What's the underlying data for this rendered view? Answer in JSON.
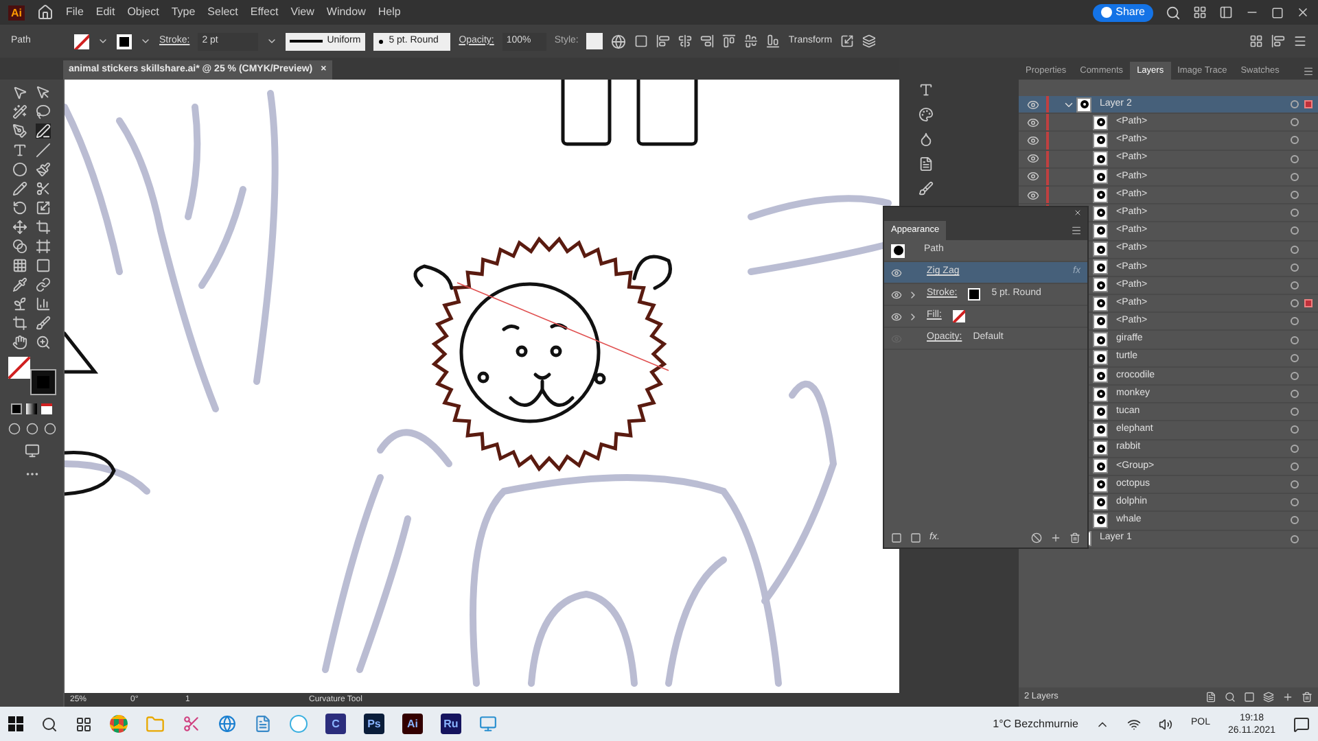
{
  "app": {
    "logo": "Ai",
    "menu": [
      "File",
      "Edit",
      "Object",
      "Type",
      "Select",
      "Effect",
      "View",
      "Window",
      "Help"
    ],
    "share_button": "Share"
  },
  "control_bar": {
    "selection": "Path",
    "stroke_label": "Stroke:",
    "stroke_weight": "2 pt",
    "profile": "Uniform",
    "brush": "5 pt. Round",
    "opacity_label": "Opacity:",
    "opacity": "100%",
    "style_label": "Style:",
    "transform": "Transform"
  },
  "document_tab": {
    "title": "animal stickers skillshare.ai* @ 25 % (CMYK/Preview)",
    "close": "×"
  },
  "panel_tabs": [
    {
      "label": "Properties",
      "selected": false
    },
    {
      "label": "Comments",
      "selected": false
    },
    {
      "label": "Layers",
      "selected": true
    },
    {
      "label": "Image Trace",
      "selected": false
    },
    {
      "label": "Swatches",
      "selected": false
    }
  ],
  "layers": [
    {
      "name": "Layer 2",
      "expanded": true,
      "active": true,
      "selected": true,
      "children": [
        {
          "name": "<Path>",
          "selected": false
        },
        {
          "name": "<Path>",
          "selected": false
        },
        {
          "name": "<Path>",
          "selected": false
        },
        {
          "name": "<Path>",
          "selected": false
        },
        {
          "name": "<Path>",
          "selected": false
        },
        {
          "name": "<Path>",
          "selected": false
        },
        {
          "name": "<Path>",
          "selected": false
        },
        {
          "name": "<Path>",
          "selected": false
        },
        {
          "name": "<Path>",
          "selected": false
        },
        {
          "name": "<Path>",
          "selected": false
        },
        {
          "name": "<Path>",
          "selected": true
        },
        {
          "name": "<Path>",
          "selected": false
        },
        {
          "name": "giraffe",
          "selected": false
        },
        {
          "name": "turtle",
          "selected": false
        },
        {
          "name": "crocodile",
          "selected": false
        },
        {
          "name": "monkey",
          "selected": false
        },
        {
          "name": "tucan",
          "selected": false
        },
        {
          "name": "elephant",
          "selected": false
        },
        {
          "name": "rabbit",
          "selected": false
        },
        {
          "name": "<Group>",
          "selected": false
        },
        {
          "name": "octopus",
          "selected": false
        },
        {
          "name": "dolphin",
          "selected": false
        },
        {
          "name": "whale",
          "selected": false
        }
      ]
    },
    {
      "name": "Layer 1",
      "active": false,
      "selected": false
    }
  ],
  "layers_count": "2 Layers",
  "appearance": {
    "title": "Appearance",
    "object": "Path",
    "footer_fx": "fx.",
    "items": [
      {
        "kind": "effect",
        "label": "Zig Zag",
        "badge": "fx",
        "selected": true
      },
      {
        "kind": "stroke",
        "label": "Stroke:",
        "value": "5 pt. Round",
        "selected": false
      },
      {
        "kind": "fill",
        "label": "Fill:",
        "selected": false
      },
      {
        "kind": "opacity",
        "label": "Opacity:",
        "value": "Default",
        "selected": false
      }
    ]
  },
  "status_bar": {
    "zoom": "25%",
    "rotation": "0°",
    "artboard": "1",
    "tool": "Curvature Tool"
  },
  "taskbar": {
    "apps": [
      {
        "label": "C",
        "color": "#2b2d7c"
      },
      {
        "label": "Ps",
        "color": "#0a1d3a"
      },
      {
        "label": "Ai",
        "color": "#330000"
      },
      {
        "label": "Ru",
        "color": "#15145e"
      }
    ],
    "weather": "1°C Bezchmurnie",
    "language": "POL",
    "time": "19:18",
    "date": "26.11.2021"
  }
}
